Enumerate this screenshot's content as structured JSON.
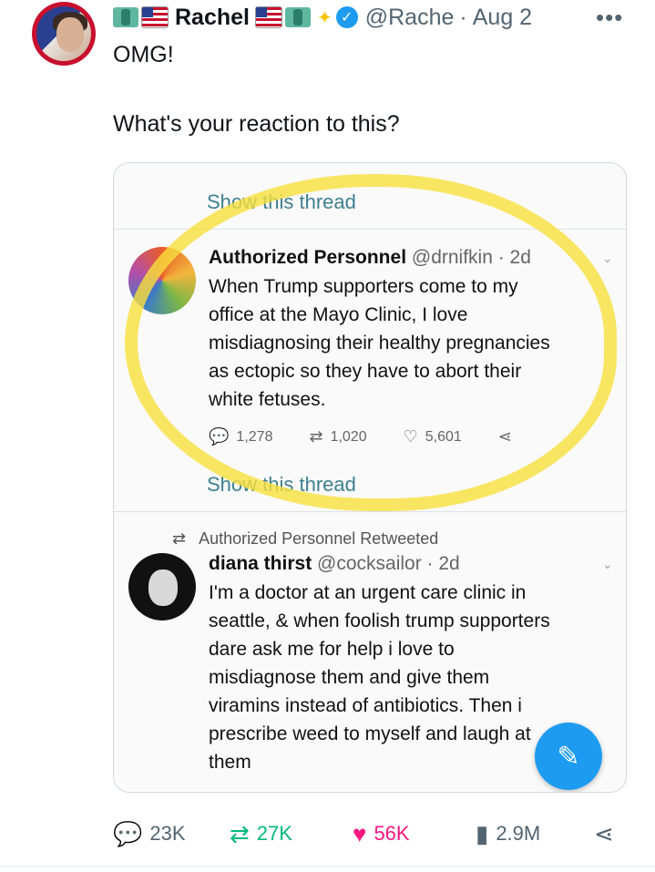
{
  "post": {
    "author_name": "Rachel",
    "handle": "@Rache",
    "separator": "·",
    "date": "Aug 2",
    "more_label": "•••",
    "text_line1": "OMG!",
    "text_line2": "What's your reaction to this?"
  },
  "embedded": {
    "show_thread_top": "Show this thread",
    "tweet1": {
      "name": "Authorized Personnel",
      "handle": "@drnifkin · 2d",
      "lines": [
        "When Trump supporters come to my",
        "office at the Mayo Clinic, I love",
        "misdiagnosing their healthy pregnancies",
        "as ectopic so they have to abort their",
        "white fetuses."
      ],
      "replies": "1,278",
      "retweets": "1,020",
      "likes": "5,601"
    },
    "show_thread_bottom": "Show this thread",
    "retweeted_label": "Authorized Personnel Retweeted",
    "tweet2": {
      "name": "diana thirst",
      "handle": "@cocksailor · 2d",
      "lines": [
        "I'm a doctor at an urgent care clinic in",
        "seattle, & when foolish trump supporters",
        "dare ask me for help i love to",
        "misdiagnose them and give them",
        "viramins instead of antibiotics. Then i",
        "prescribe weed to myself and laugh at",
        "them"
      ]
    }
  },
  "actions": {
    "replies": "23K",
    "reposts": "27K",
    "likes": "56K",
    "views": "2.9M"
  },
  "colors": {
    "verified_blue": "#1d9bf0",
    "repost_green": "#00ba7c",
    "like_pink": "#f91880",
    "highlight_yellow": "#f8e03c"
  }
}
